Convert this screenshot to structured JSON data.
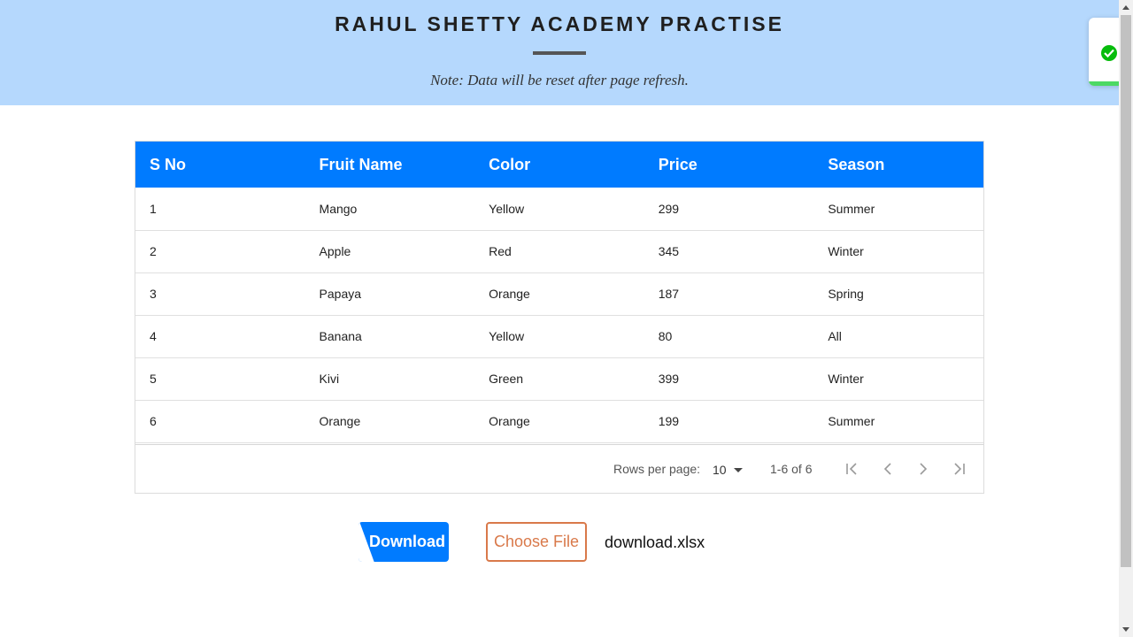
{
  "header": {
    "title": "RAHUL SHETTY ACADEMY PRACTISE",
    "note": "Note: Data will be reset after page refresh."
  },
  "colors": {
    "header_bg": "#b5d8fd",
    "table_header_bg": "#007bff",
    "download_button_bg": "#007bff",
    "choose_file_accent": "#d9794a",
    "toast_success": "#07bc0c"
  },
  "toast": {
    "icon": "check-circle-icon"
  },
  "table": {
    "columns": [
      "S No",
      "Fruit Name",
      "Color",
      "Price",
      "Season"
    ],
    "rows": [
      [
        "1",
        "Mango",
        "Yellow",
        "299",
        "Summer"
      ],
      [
        "2",
        "Apple",
        "Red",
        "345",
        "Winter"
      ],
      [
        "3",
        "Papaya",
        "Orange",
        "187",
        "Spring"
      ],
      [
        "4",
        "Banana",
        "Yellow",
        "80",
        "All"
      ],
      [
        "5",
        "Kivi",
        "Green",
        "399",
        "Winter"
      ],
      [
        "6",
        "Orange",
        "Orange",
        "199",
        "Summer"
      ]
    ]
  },
  "pagination": {
    "rows_per_page_label": "Rows per page:",
    "rows_per_page_value": "10",
    "range": "1-6 of 6",
    "icons": [
      "first-page-icon",
      "previous-page-icon",
      "next-page-icon",
      "last-page-icon"
    ]
  },
  "actions": {
    "download_label": "Download",
    "choose_file_label": "Choose File",
    "file_name": "download.xlsx"
  }
}
